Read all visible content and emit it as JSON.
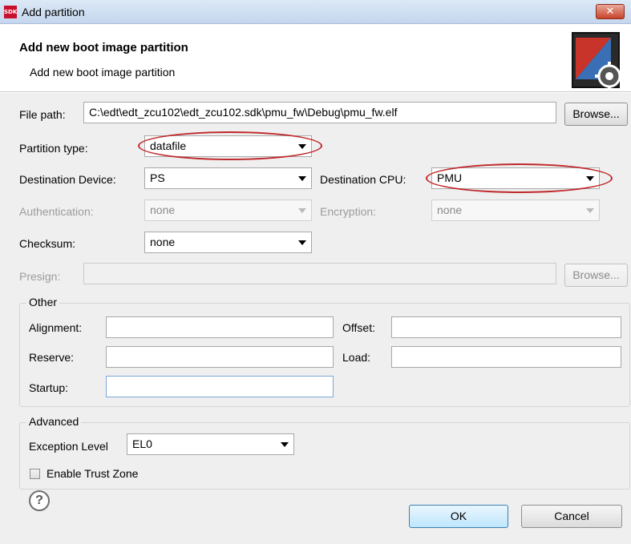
{
  "window": {
    "title": "Add partition",
    "app_icon_text": "SDK",
    "close_glyph": "✕"
  },
  "header": {
    "title": "Add new boot image partition",
    "subtitle": "Add new boot image partition"
  },
  "file_path": {
    "label": "File path:",
    "value": "C:\\edt\\edt_zcu102\\edt_zcu102.sdk\\pmu_fw\\Debug\\pmu_fw.elf",
    "browse": "Browse..."
  },
  "partition_type": {
    "label": "Partition type:",
    "value": "datafile"
  },
  "destination_device": {
    "label": "Destination Device:",
    "value": "PS"
  },
  "destination_cpu": {
    "label": "Destination CPU:",
    "value": "PMU"
  },
  "authentication": {
    "label": "Authentication:",
    "value": "none"
  },
  "encryption": {
    "label": "Encryption:",
    "value": "none"
  },
  "checksum": {
    "label": "Checksum:",
    "value": "none"
  },
  "presign": {
    "label": "Presign:",
    "value": "",
    "browse": "Browse..."
  },
  "other": {
    "title": "Other",
    "alignment": {
      "label": "Alignment:",
      "value": ""
    },
    "offset": {
      "label": "Offset:",
      "value": ""
    },
    "reserve": {
      "label": "Reserve:",
      "value": ""
    },
    "load": {
      "label": "Load:",
      "value": ""
    },
    "startup": {
      "label": "Startup:",
      "value": ""
    }
  },
  "advanced": {
    "title": "Advanced",
    "exception_level": {
      "label": "Exception Level",
      "value": "EL0"
    },
    "trust_zone": {
      "label": "Enable Trust Zone",
      "checked": false
    }
  },
  "buttons": {
    "help": "?",
    "ok": "OK",
    "cancel": "Cancel"
  },
  "colors": {
    "highlight_ellipse": "#c0282b",
    "default_button": "#3c7fb1",
    "title_bar": "#c5d7ee"
  }
}
